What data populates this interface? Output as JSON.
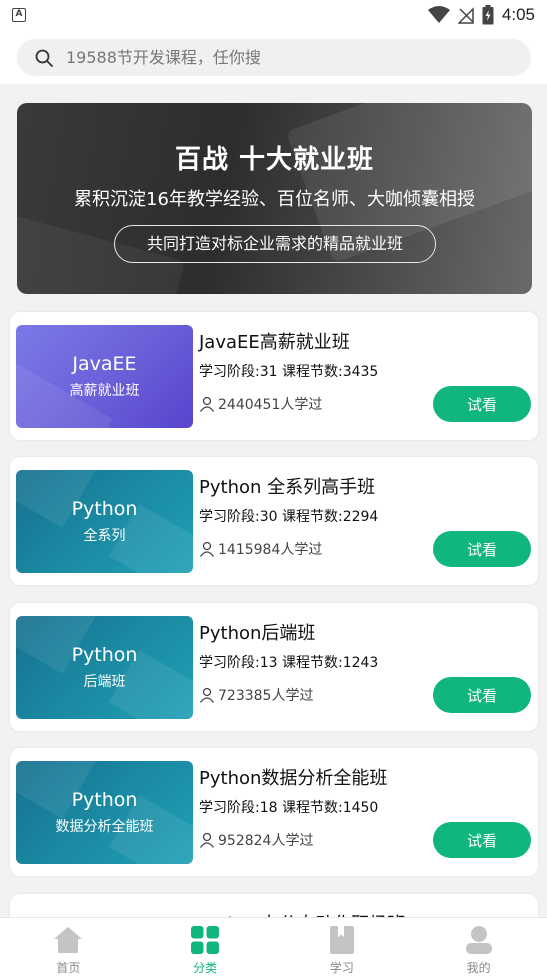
{
  "status_bar": {
    "time": "4:05",
    "badge": "A"
  },
  "search": {
    "placeholder": "19588节开发课程，任你搜"
  },
  "banner": {
    "title": "百战 十大就业班",
    "subtitle": "累积沉淀16年教学经验、百位名师、大咖倾囊相授",
    "pill": "共同打造对标企业需求的精品就业班"
  },
  "courses": [
    {
      "name": "JavaEE高薪就业班",
      "meta": "学习阶段:31  课程节数:3435",
      "learners": "2440451人学过",
      "thumb_line1": "JavaEE",
      "thumb_line2": "高薪就业班",
      "button": "试看"
    },
    {
      "name": "Python 全系列高手班",
      "meta": "学习阶段:30  课程节数:2294",
      "learners": "1415984人学过",
      "thumb_line1": "Python",
      "thumb_line2": "全系列",
      "button": "试看"
    },
    {
      "name": "Python后端班",
      "meta": "学习阶段:13  课程节数:1243",
      "learners": "723385人学过",
      "thumb_line1": "Python",
      "thumb_line2": "后端班",
      "button": "试看"
    },
    {
      "name": "Python数据分析全能班",
      "meta": "学习阶段:18  课程节数:1450",
      "learners": "952824人学过",
      "thumb_line1": "Python",
      "thumb_line2": "数据分析全能班",
      "button": "试看"
    },
    {
      "name": "Python办公自动化职场班"
    }
  ],
  "nav": {
    "items": [
      {
        "label": "首页",
        "icon": "home-icon"
      },
      {
        "label": "分类",
        "icon": "category-icon"
      },
      {
        "label": "学习",
        "icon": "book-icon"
      },
      {
        "label": "我的",
        "icon": "profile-icon"
      }
    ],
    "active_index": 1
  },
  "colors": {
    "accent": "#11b57f",
    "purple_thumb": "#6a5fd8",
    "teal_thumb": "#1b8aa3"
  }
}
